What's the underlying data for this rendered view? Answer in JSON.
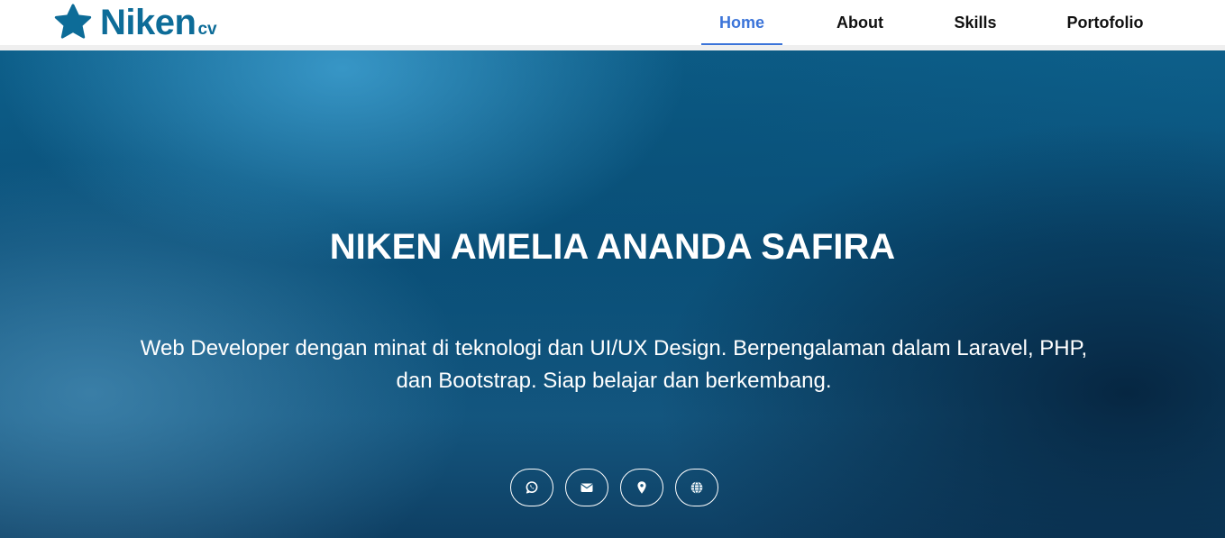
{
  "brand": {
    "name": "Niken",
    "suffix": "cv",
    "icon": "star-icon",
    "color": "#0d6c98"
  },
  "nav": {
    "items": [
      {
        "label": "Home",
        "active": true
      },
      {
        "label": "About",
        "active": false
      },
      {
        "label": "Skills",
        "active": false
      },
      {
        "label": "Portofolio",
        "active": false
      }
    ],
    "active_color": "#3b74d9"
  },
  "hero": {
    "title": "NIKEN AMELIA ANANDA SAFIRA",
    "description": "Web Developer dengan minat di teknologi dan UI/UX Design. Berpengalaman dalam Laravel, PHP, dan Bootstrap. Siap belajar dan berkembang.",
    "socials": [
      {
        "icon": "whatsapp-icon"
      },
      {
        "icon": "envelope-icon"
      },
      {
        "icon": "location-pin-icon"
      },
      {
        "icon": "globe-icon"
      }
    ]
  }
}
